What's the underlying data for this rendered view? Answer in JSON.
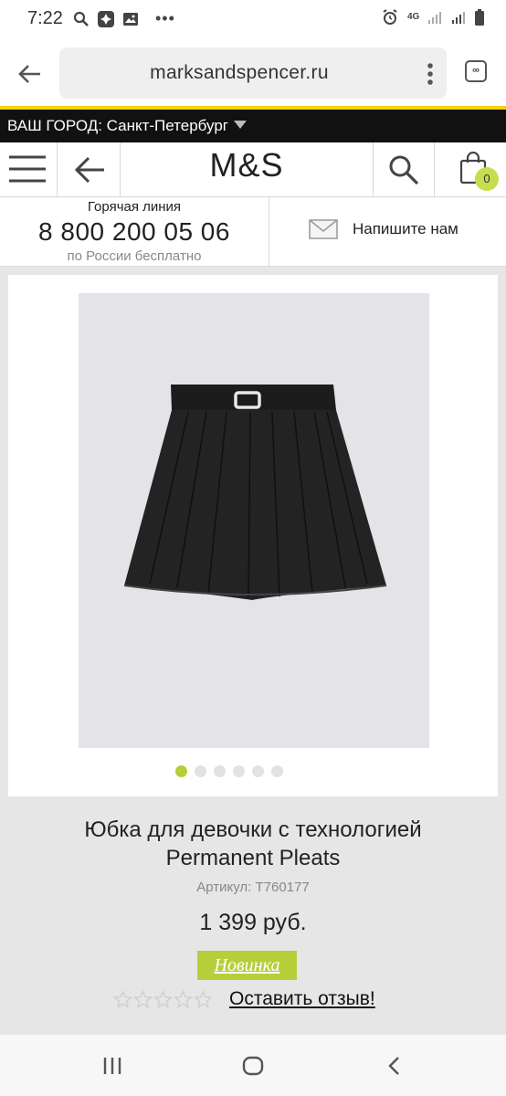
{
  "status_bar": {
    "time": "7:22",
    "network": "4G"
  },
  "browser": {
    "url": "marksandspencer.ru",
    "tab_icon_label": "∞"
  },
  "city_bar": {
    "label": "ВАШ ГОРОД: Санкт-Петербург"
  },
  "site_nav": {
    "logo": "M&S",
    "cart_count": "0"
  },
  "contact": {
    "hotline_title": "Горячая линия",
    "hotline_phone": "8 800 200 05 06",
    "hotline_note": "по России бесплатно",
    "write_us": "Напишите нам"
  },
  "gallery": {
    "image_count": 6,
    "active_index": 0
  },
  "product": {
    "title": "Юбка для девочки с технологией Permanent Pleats",
    "sku": "Артикул: T760177",
    "price": "1 399 руб.",
    "badge": "Новинка",
    "rating": 0,
    "rating_max": 5,
    "review_link": "Оставить отзыв!"
  },
  "colors": {
    "accent_lime": "#b5cf3a",
    "accent_yellow": "#f5d400",
    "city_bar_bg": "#111111"
  }
}
